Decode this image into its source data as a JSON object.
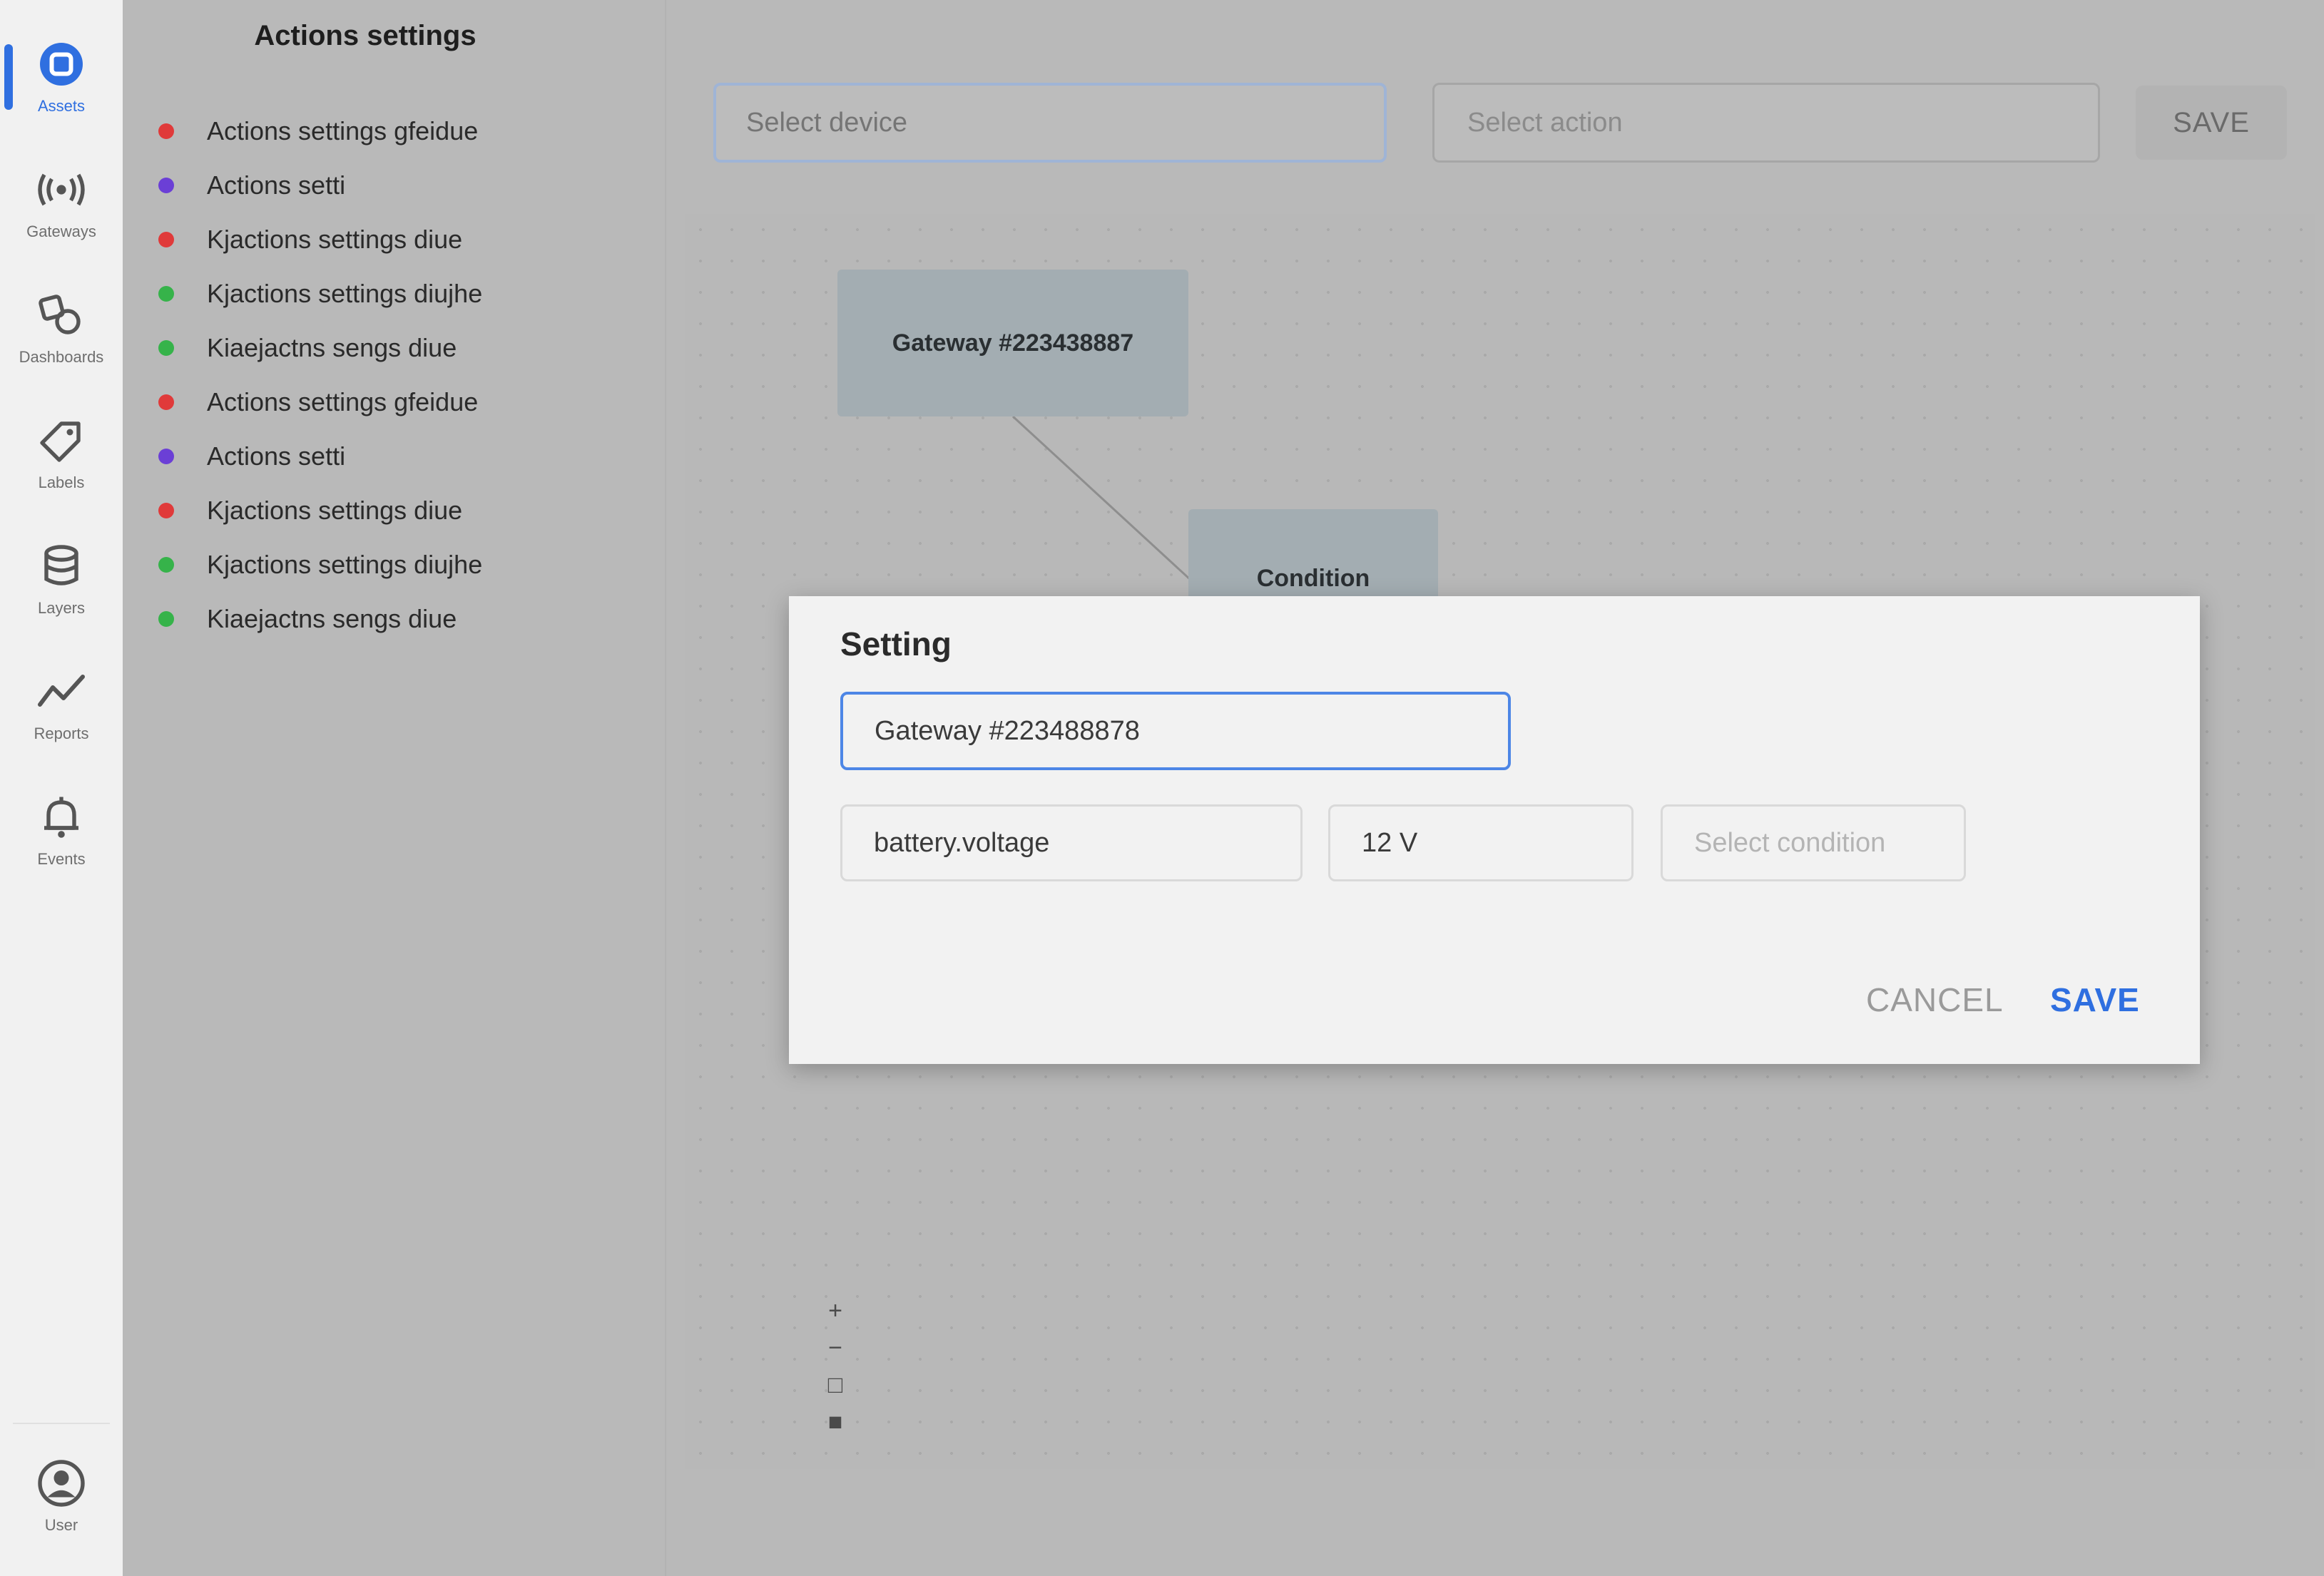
{
  "nav": {
    "items": [
      {
        "label": "Assets",
        "icon": "square-icon",
        "active": true
      },
      {
        "label": "Gateways",
        "icon": "broadcast-icon",
        "active": false
      },
      {
        "label": "Dashboards",
        "icon": "shapes-icon",
        "active": false
      },
      {
        "label": "Labels",
        "icon": "tag-icon",
        "active": false
      },
      {
        "label": "Layers",
        "icon": "database-icon",
        "active": false
      },
      {
        "label": "Reports",
        "icon": "chart-line-icon",
        "active": false
      },
      {
        "label": "Events",
        "icon": "bell-icon",
        "active": false
      }
    ],
    "user": {
      "label": "User",
      "icon": "user-icon"
    },
    "accent": "#2f6fe0"
  },
  "actions_panel": {
    "title": "Actions settings",
    "items": [
      {
        "label": "Actions settings gfeidue",
        "status_color": "#e03a3a"
      },
      {
        "label": "Actions setti",
        "status_color": "#6b3fd6"
      },
      {
        "label": "Kjactions settings diue",
        "status_color": "#e03a3a"
      },
      {
        "label": "Kjactions settings diujhe",
        "status_color": "#36b34a"
      },
      {
        "label": "Kiaejactns sengs diue",
        "status_color": "#36b34a"
      },
      {
        "label": "Actions settings gfeidue",
        "status_color": "#e03a3a"
      },
      {
        "label": "Actions setti",
        "status_color": "#6b3fd6"
      },
      {
        "label": "Kjactions settings diue",
        "status_color": "#e03a3a"
      },
      {
        "label": "Kjactions settings diujhe",
        "status_color": "#36b34a"
      },
      {
        "label": "Kiaejactns sengs diue",
        "status_color": "#36b34a"
      }
    ]
  },
  "toolbar": {
    "device_placeholder": "Select device",
    "action_placeholder": "Select action",
    "save_label": "SAVE"
  },
  "canvas": {
    "gateway_node": "Gateway #223438887",
    "condition_node": "Condition",
    "zoom": {
      "in": "+",
      "out": "−",
      "fit": "□",
      "lock": "■"
    }
  },
  "modal": {
    "title": "Setting",
    "gateway_value": "Gateway #223488878",
    "parameter_value": "battery.voltage",
    "threshold_value": "12 V",
    "condition_placeholder": "Select condition",
    "cancel_label": "CANCEL",
    "save_label": "SAVE"
  }
}
